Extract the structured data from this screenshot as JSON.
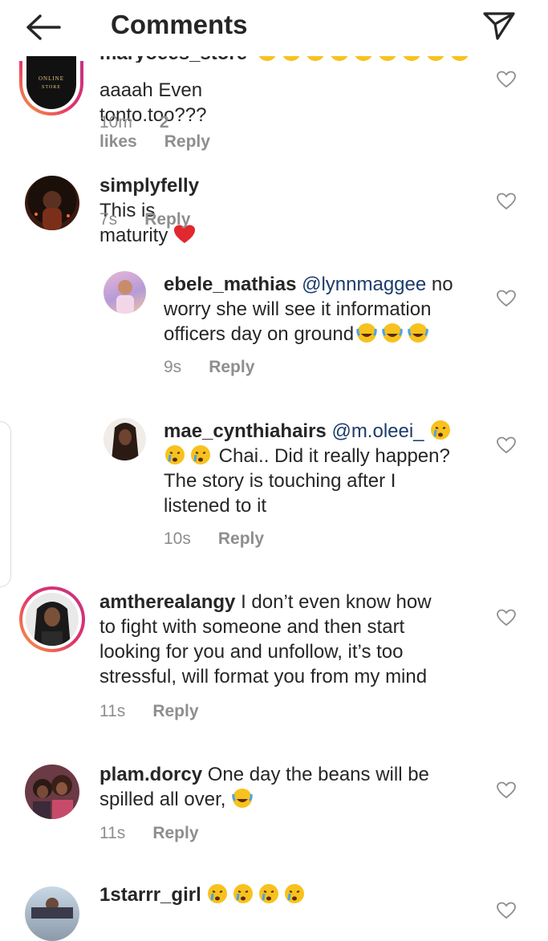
{
  "header": {
    "title": "Comments",
    "back_icon": "back-arrow-icon",
    "send_icon": "send-icon"
  },
  "comments": [
    {
      "username": "maryoees_store",
      "text": "aaaah Even tonto.too???",
      "time": "10m",
      "likes": "2 likes",
      "reply": "Reply",
      "avatar_text_1": "ONLINE",
      "avatar_text_2": "STORE"
    },
    {
      "username": "simplyfelly",
      "text": "This is maturity",
      "time": "7s",
      "reply": "Reply"
    },
    {
      "username": "ebele_mathias",
      "mention": "@lynnmaggee",
      "text_1": " no",
      "text_2": "worry she will see it information",
      "text_3": "officers day on ground",
      "time": "9s",
      "reply": "Reply"
    },
    {
      "username": "mae_cynthiahairs",
      "mention": "@m.oleei_",
      "text_2": " Chai.. Did it really happen?",
      "text_3": "The story is touching after I",
      "text_4": "listened to it",
      "time": "10s",
      "reply": "Reply"
    },
    {
      "username": "amtherealangy",
      "text_1": " I don’t even know how",
      "text_2": "to fight with someone and then start",
      "text_3": "looking for you and unfollow, it’s too",
      "text_4": "stressful, will format you from my mind",
      "time": "11s",
      "reply": "Reply"
    },
    {
      "username": "plam.dorcy",
      "text_1": " One day the beans will be",
      "text_2": "spilled  all over,",
      "time": "11s",
      "reply": "Reply"
    },
    {
      "username": "1starrr_girl"
    }
  ],
  "colors": {
    "mention": "#1c3c6b",
    "meta": "#8e8e8e",
    "heart_emoji": "#e0282e",
    "emoji_face": "#f7c21e"
  }
}
